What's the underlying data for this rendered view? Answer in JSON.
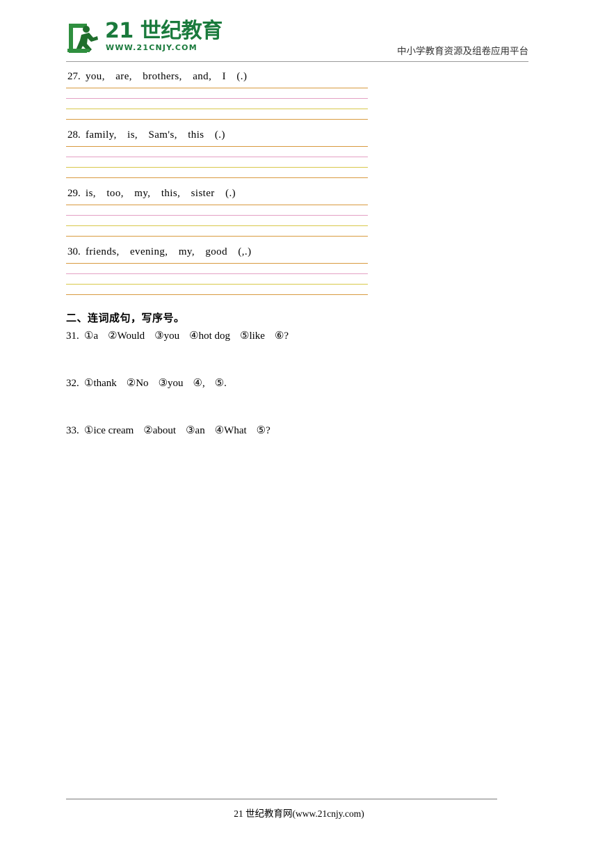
{
  "header": {
    "logo_text": "21 世纪教育",
    "logo_sub": "WWW.21CNJY.COM",
    "logo_icon": "running-person-logo-icon",
    "right_text": "中小学教育资源及组卷应用平台"
  },
  "section_one_items": [
    {
      "num": "27.",
      "words": "you,　are,　brothers,　and,　I　(.)"
    },
    {
      "num": "28.",
      "words": "family,　is,　Sam's,　this　(.)"
    },
    {
      "num": "29.",
      "words": "is,　too,　my,　this,　sister　(.)"
    },
    {
      "num": "30.",
      "words": "friends,　evening,　my,　good　(,.)"
    }
  ],
  "line_colors": [
    "#d89a3f",
    "#e4a0c4",
    "#d8c84a",
    "#d89a3f"
  ],
  "section_two": {
    "title": "二、连词成句，写序号。",
    "items": [
      {
        "num": "31.",
        "parts": [
          "①a",
          "②Would",
          "③you",
          "④hot dog",
          "⑤like",
          "⑥?"
        ]
      },
      {
        "num": "32.",
        "parts": [
          "①thank",
          "②No",
          "③you",
          "④,",
          "⑤."
        ]
      },
      {
        "num": "33.",
        "parts": [
          "①ice cream",
          "②about",
          "③an",
          "④What",
          "⑤?"
        ]
      }
    ]
  },
  "footer": {
    "text": "21 世纪教育网(www.21cnjy.com)"
  }
}
